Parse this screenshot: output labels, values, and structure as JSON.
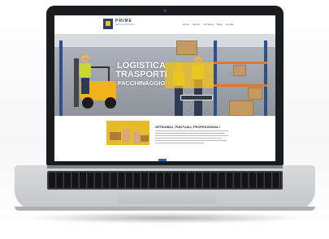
{
  "site": {
    "logo_text": "PRIME",
    "logo_sub": "SERVIZI INTEGRATI",
    "menu": [
      "Home",
      "Servizi",
      "Chi siamo",
      "Blog",
      "Contatti"
    ]
  },
  "hero": {
    "line1": "LOGISTICA",
    "line2": "TRASPORTI",
    "line3": "FACCHINAGGIO"
  },
  "feature": {
    "title": "AFFIDABILI, PUNTUALI, PROFESSIONALI"
  },
  "colors": {
    "accent_yellow": "#f2c21b",
    "brand_navy": "#2a3f66",
    "button_blue": "#2a66b8"
  }
}
